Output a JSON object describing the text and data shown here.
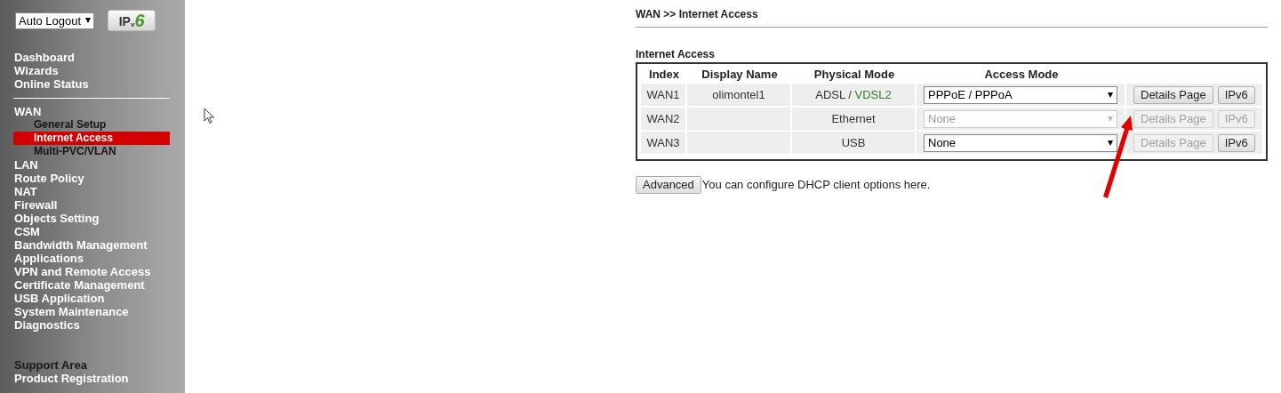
{
  "sidebar": {
    "auto_logout": {
      "value": "Auto Logout"
    },
    "ipv6_logo": {
      "text": "IP",
      "sub": "v",
      "six": "6"
    },
    "groups": [
      {
        "items": [
          {
            "label": "Dashboard",
            "kind": "main"
          },
          {
            "label": "Wizards",
            "kind": "main"
          },
          {
            "label": "Online Status",
            "kind": "main"
          }
        ]
      },
      {
        "items": [
          {
            "label": "WAN",
            "kind": "main"
          },
          {
            "label": "General Setup",
            "kind": "sub",
            "selected": false
          },
          {
            "label": "Internet Access",
            "kind": "sub",
            "selected": true
          },
          {
            "label": "Multi-PVC/VLAN",
            "kind": "sub",
            "selected": false
          },
          {
            "label": "LAN",
            "kind": "main"
          },
          {
            "label": "Route Policy",
            "kind": "main"
          },
          {
            "label": "NAT",
            "kind": "main"
          },
          {
            "label": "Firewall",
            "kind": "main"
          },
          {
            "label": "Objects Setting",
            "kind": "main"
          },
          {
            "label": "CSM",
            "kind": "main"
          },
          {
            "label": "Bandwidth Management",
            "kind": "main"
          },
          {
            "label": "Applications",
            "kind": "main"
          },
          {
            "label": "VPN and Remote Access",
            "kind": "main"
          },
          {
            "label": "Certificate Management",
            "kind": "main"
          },
          {
            "label": "USB Application",
            "kind": "main"
          },
          {
            "label": "System Maintenance",
            "kind": "main"
          },
          {
            "label": "Diagnostics",
            "kind": "main"
          }
        ]
      },
      {
        "items": [
          {
            "label": "Support Area",
            "kind": "label"
          },
          {
            "label": "Product Registration",
            "kind": "main"
          }
        ]
      }
    ]
  },
  "breadcrumb": "WAN >> Internet Access",
  "section_title": "Internet Access",
  "table": {
    "columns": [
      "Index",
      "Display Name",
      "Physical Mode",
      "Access Mode"
    ],
    "rows": [
      {
        "index": "WAN1",
        "display_name": "olimontel1",
        "physical_mode": [
          {
            "text": "ADSL / ",
            "active": false
          },
          {
            "text": "VDSL2",
            "active": true
          }
        ],
        "access_mode": "PPPoE / PPPoA",
        "access_disabled": false,
        "details": "Details Page",
        "details_disabled": false,
        "ipv6": "IPv6",
        "ipv6_disabled": false
      },
      {
        "index": "WAN2",
        "physical_mode": [
          {
            "text": "Ethernet",
            "active": false
          }
        ],
        "access_mode": "None",
        "access_disabled": true,
        "details": "Details Page",
        "details_disabled": true,
        "ipv6": "IPv6",
        "ipv6_disabled": true
      },
      {
        "index": "WAN3",
        "physical_mode": [
          {
            "text": "USB",
            "active": false
          }
        ],
        "access_mode": "None",
        "access_disabled": false,
        "details": "Details Page",
        "details_disabled": true,
        "ipv6": "IPv6",
        "ipv6_disabled": false
      }
    ]
  },
  "advanced": {
    "button": "Advanced",
    "note": "You can configure DHCP client options here."
  },
  "annotation": {
    "kind": "arrow"
  },
  "cursor": {
    "kind": "pointer"
  }
}
